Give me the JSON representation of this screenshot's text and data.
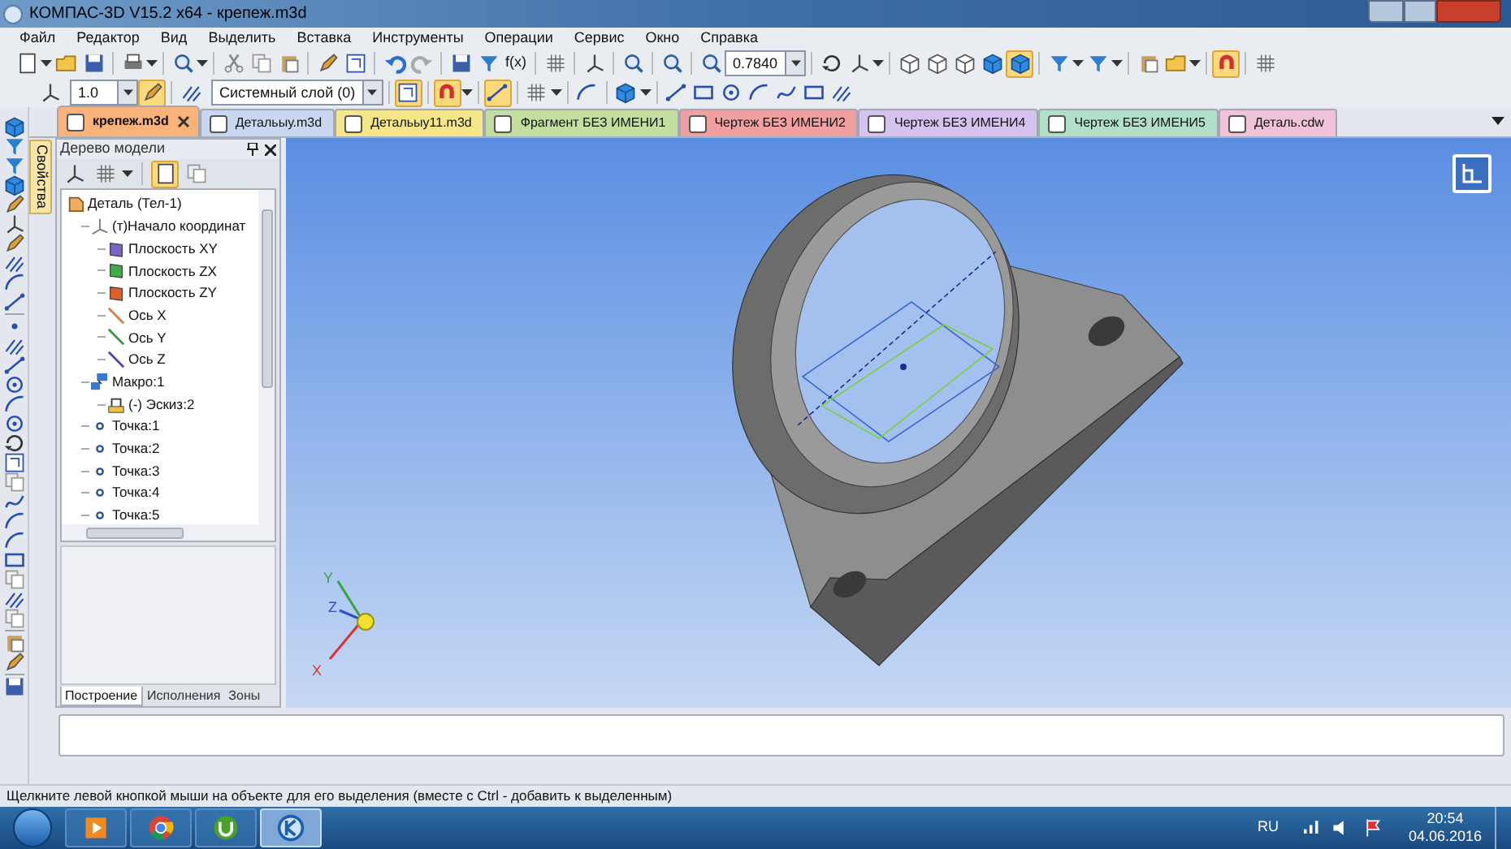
{
  "window": {
    "title": "КОМПАС-3D V15.2  x64 - крепеж.m3d"
  },
  "menu": [
    "Файл",
    "Редактор",
    "Вид",
    "Выделить",
    "Вставка",
    "Инструменты",
    "Операции",
    "Сервис",
    "Окно",
    "Справка"
  ],
  "toolbar": {
    "formula_button": "f(x)",
    "zoom_value": "0.7840"
  },
  "toolbar2": {
    "step_value": "1.0",
    "layer": "Системный слой (0)"
  },
  "tabs": [
    {
      "label": "крепеж.m3d",
      "selected": true,
      "color": "#f9b27a",
      "closable": true
    },
    {
      "label": "Детальыу.m3d",
      "selected": false,
      "color": "#c9d8f0"
    },
    {
      "label": "Детальыу11.m3d",
      "selected": false,
      "color": "#f6e68a"
    },
    {
      "label": "Фрагмент БЕЗ ИМЕНИ1",
      "selected": false,
      "color": "#c4dea0"
    },
    {
      "label": "Чертеж БЕЗ ИМЕНИ2",
      "selected": false,
      "color": "#f0a0a0"
    },
    {
      "label": "Чертеж БЕЗ ИМЕНИ4",
      "selected": false,
      "color": "#d5c2ef"
    },
    {
      "label": "Чертеж БЕЗ ИМЕНИ5",
      "selected": false,
      "color": "#b2dfc9"
    },
    {
      "label": "Деталь.cdw",
      "selected": false,
      "color": "#f1c3d9"
    }
  ],
  "side_tab": "Свойства",
  "model_tree": {
    "title": "Дерево модели",
    "items": [
      {
        "label": "Деталь (Тел-1)",
        "kind": "part",
        "children": [
          {
            "label": "(т)Начало координат",
            "kind": "origin",
            "children": [
              {
                "label": "Плоскость XY",
                "kind": "plane",
                "color": "#7b62c8"
              },
              {
                "label": "Плоскость ZX",
                "kind": "plane",
                "color": "#3fae4a"
              },
              {
                "label": "Плоскость ZY",
                "kind": "plane",
                "color": "#e0602a"
              },
              {
                "label": "Ось X",
                "kind": "axis",
                "color": "#e07a40"
              },
              {
                "label": "Ось Y",
                "kind": "axis",
                "color": "#3a9a3a"
              },
              {
                "label": "Ось Z",
                "kind": "axis",
                "color": "#5a3ab0"
              }
            ]
          },
          {
            "label": "Макро:1",
            "kind": "macro",
            "children": [
              {
                "label": "(-) Эскиз:2",
                "kind": "sketch"
              }
            ]
          },
          {
            "label": "Точка:1",
            "kind": "point"
          },
          {
            "label": "Точка:2",
            "kind": "point"
          },
          {
            "label": "Точка:3",
            "kind": "point"
          },
          {
            "label": "Точка:4",
            "kind": "point"
          },
          {
            "label": "Точка:5",
            "kind": "point"
          }
        ]
      }
    ]
  },
  "panel_tabs": [
    {
      "label": "Построение",
      "selected": true
    },
    {
      "label": "Исполнения",
      "selected": false
    },
    {
      "label": "Зоны",
      "selected": false
    }
  ],
  "viewport": {
    "axis_labels": [
      "Y",
      "Z",
      "X"
    ]
  },
  "status_bar": "Щелкните левой кнопкой мыши на объекте для его выделения (вместе с Ctrl - добавить к выделенным)",
  "taskbar": {
    "language": "RU",
    "time": "20:54",
    "date": "04.06.2016"
  }
}
